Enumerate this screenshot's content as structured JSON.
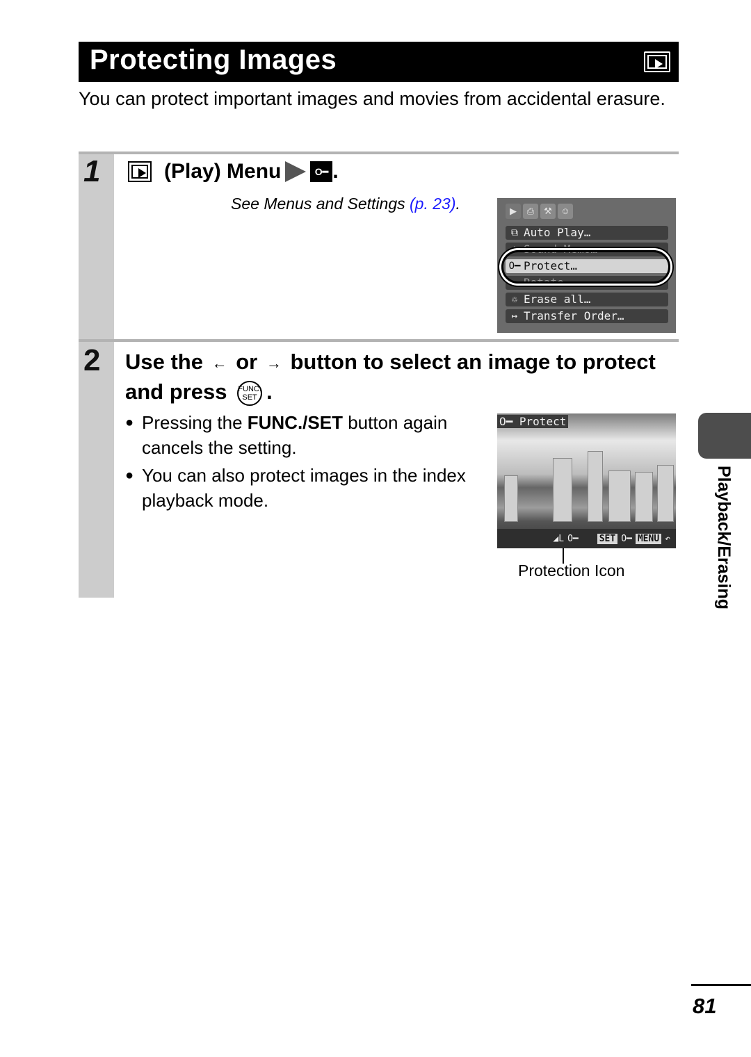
{
  "header": {
    "title": "Protecting Images",
    "mode_icon": "play-mode-icon"
  },
  "intro": "You can protect important images and movies from accidental erasure.",
  "steps": [
    {
      "number": "1",
      "heading": {
        "prefix_icon": "play-icon",
        "label": "(Play) Menu",
        "separator_icon": "arrow-right-icon",
        "target_icon": "key-icon",
        "target_glyph": "O━",
        "suffix": "."
      },
      "reference": {
        "text": "See Menus and Settings ",
        "link": "(p. 23)",
        "suffix": "."
      },
      "screen": {
        "tabs": [
          {
            "icon": "play-tab-icon",
            "glyph": "▶"
          },
          {
            "icon": "print-tab-icon",
            "glyph": "⎙"
          },
          {
            "icon": "tools-tab-icon",
            "glyph": "⚒"
          },
          {
            "icon": "my-camera-tab-icon",
            "glyph": "☺"
          }
        ],
        "items": [
          {
            "label": "Auto Play…",
            "icon": "auto-play-icon",
            "glyph": "⧉"
          },
          {
            "label": "Sound Memo…",
            "icon": "microphone-icon",
            "glyph": "♠"
          },
          {
            "label": "Protect…",
            "icon": "key-icon",
            "glyph": "O━",
            "selected": true
          },
          {
            "label": "Rotate…",
            "icon": "rotate-icon",
            "glyph": "↻"
          },
          {
            "label": "Erase all…",
            "icon": "trash-icon",
            "glyph": "♲"
          },
          {
            "label": "Transfer Order…",
            "icon": "transfer-icon",
            "glyph": "↦"
          }
        ]
      }
    },
    {
      "number": "2",
      "heading": {
        "part1": "Use the",
        "left_arrow": "←",
        "or": "or",
        "right_arrow": "→",
        "part2": "button to select an image to protect and press",
        "button_top": "FUNC.",
        "button_bottom": "SET",
        "suffix": "."
      },
      "bullets": [
        {
          "pre": "Pressing the ",
          "bold": "FUNC./SET",
          "post": " button again cancels the setting."
        },
        {
          "pre": "You can also protect images in the index playback mode.",
          "bold": "",
          "post": ""
        }
      ],
      "photo": {
        "overlay_label": "Protect",
        "overlay_icon": "key-icon",
        "status_bar": {
          "quality": "◢L",
          "protect_glyph": "O━",
          "set": "SET",
          "menu": "MENU",
          "back": "↶"
        },
        "callout": "Protection Icon"
      }
    }
  ],
  "side_tab": {
    "label": "Playback/Erasing"
  },
  "page_number": "81"
}
